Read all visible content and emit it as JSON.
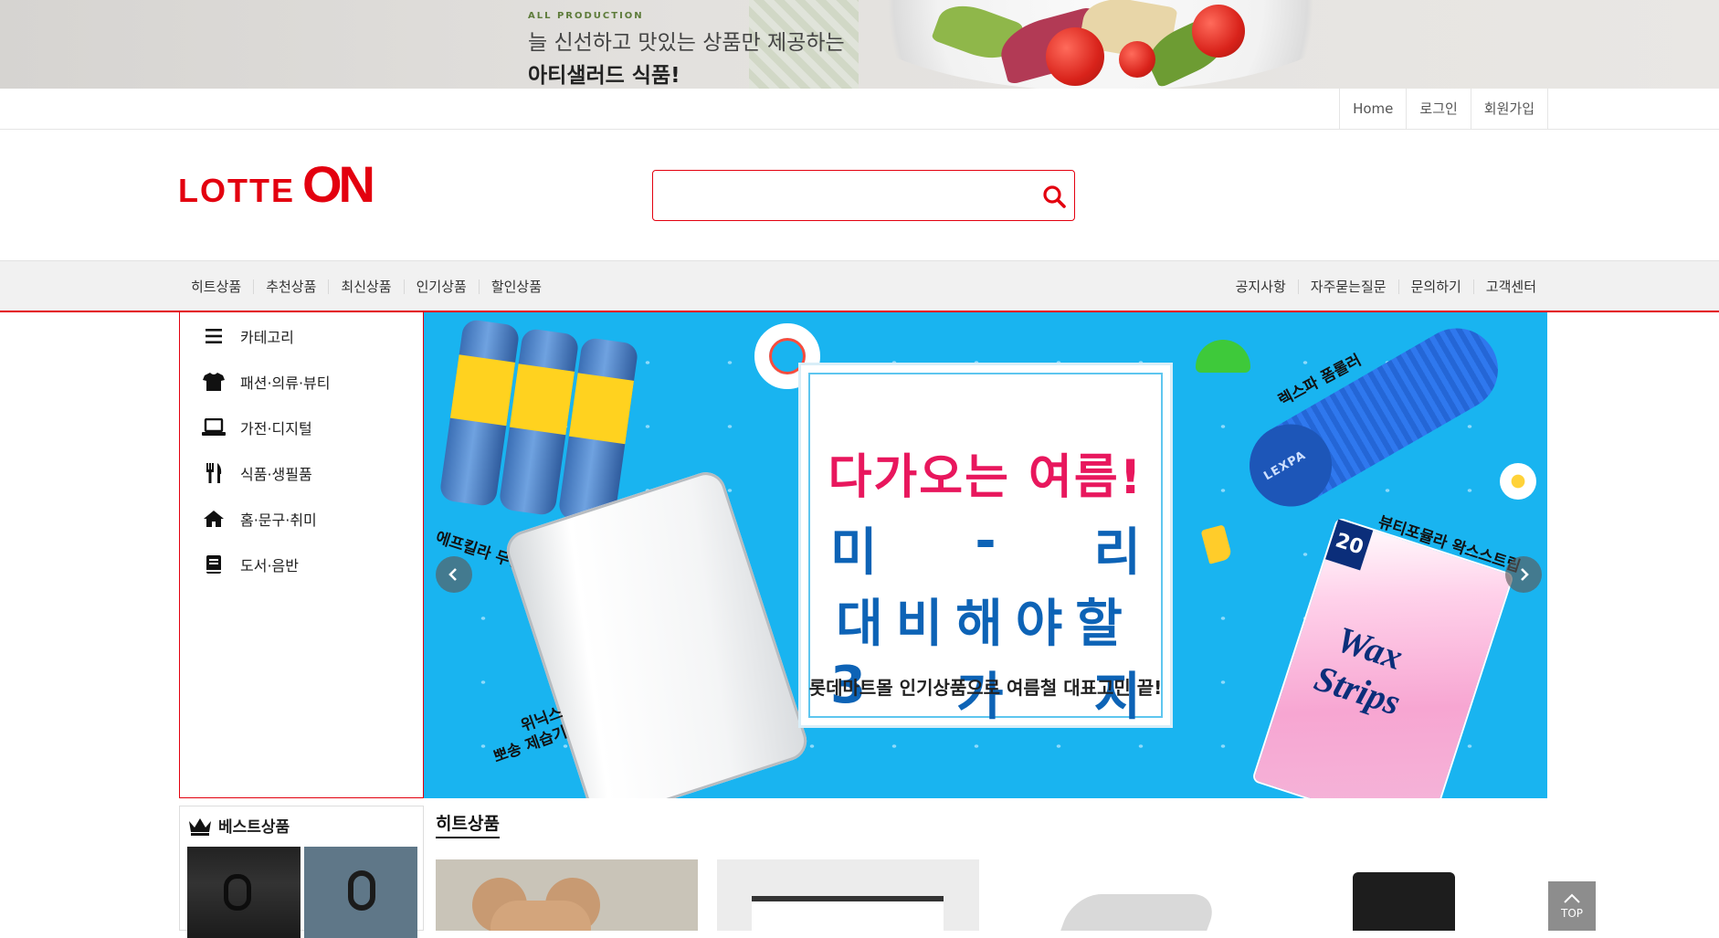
{
  "top_banner": {
    "kicker": "ALL PRODUCTION",
    "line1": "늘 신선하고 맛있는 상품만 제공하는",
    "line2": "아티샐러드 식품!"
  },
  "util_nav": {
    "home": "Home",
    "login": "로그인",
    "signup": "회원가입"
  },
  "logo": {
    "word": "LOTTE",
    "on": "ON"
  },
  "search": {
    "placeholder": "",
    "value": ""
  },
  "gnb": {
    "left": [
      "히트상품",
      "추천상품",
      "최신상품",
      "인기상품",
      "할인상품"
    ],
    "right": [
      "공지사항",
      "자주묻는질문",
      "문의하기",
      "고객센터"
    ]
  },
  "categories": [
    {
      "label": "카테고리",
      "icon": "menu-icon"
    },
    {
      "label": "패션·의류·뷰티",
      "icon": "tshirt-icon"
    },
    {
      "label": "가전·디지털",
      "icon": "laptop-icon"
    },
    {
      "label": "식품·생필품",
      "icon": "utensils-icon"
    },
    {
      "label": "홈·문구·취미",
      "icon": "home-icon"
    },
    {
      "label": "도서·음반",
      "icon": "book-icon"
    }
  ],
  "slider": {
    "headline": "다가오는 여름!",
    "line_a": [
      "미",
      "-",
      "리"
    ],
    "line_b": "대비해야할",
    "line_c": [
      "3",
      "가",
      "지"
    ],
    "sub": "롯데마트몰 인기상품으로 여름철 대표고민 끝!",
    "labels": {
      "spray": "에프킬라 무향",
      "dehumidifier_1": "위닉스",
      "dehumidifier_2": "뽀송 제습기",
      "roller": "렉스파 폼롤러",
      "wax": "뷰티포뮬라 왁스스트립",
      "roller_brand": "LEXPA",
      "wax_1": "Wax",
      "wax_2": "Strips"
    },
    "colors": {
      "bg": "#19b4f0",
      "title": "#e8175d",
      "body": "#0d63b6"
    }
  },
  "best": {
    "title": "베스트상품"
  },
  "hit": {
    "title": "히트상품"
  },
  "top_button": {
    "label": "TOP"
  },
  "colors": {
    "brand": "#e3000f",
    "gnb_bg": "#f1f1f1"
  }
}
